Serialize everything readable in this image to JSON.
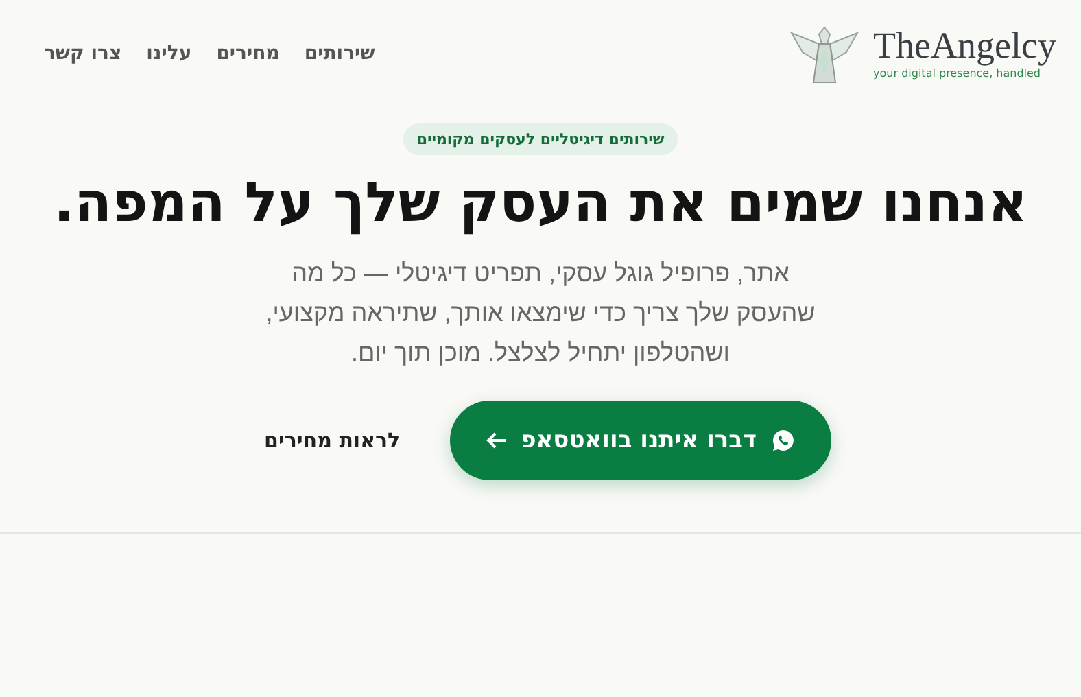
{
  "logo": {
    "name": "TheAngelcy",
    "tagline": "your digital presence, handled"
  },
  "nav": [
    {
      "label": "שירותים"
    },
    {
      "label": "מחירים"
    },
    {
      "label": "עלינו"
    },
    {
      "label": "צרו קשר"
    }
  ],
  "hero": {
    "badge": "שירותים דיגיטליים לעסקים מקומיים",
    "title": "אנחנו שמים את העסק שלך על המפה.",
    "description": "אתר, פרופיל גוגל עסקי, תפריט דיגיטלי — כל מה שהעסק שלך צריך כדי שימצאו אותך, שתיראה מקצועי, ושהטלפון יתחיל לצלצל. מוכן תוך יום.",
    "buttons": [
      {
        "kind": "primary",
        "label": "דברו איתנו בוואטסאפ"
      },
      {
        "kind": "link",
        "label": "לראות מחירים"
      }
    ]
  }
}
